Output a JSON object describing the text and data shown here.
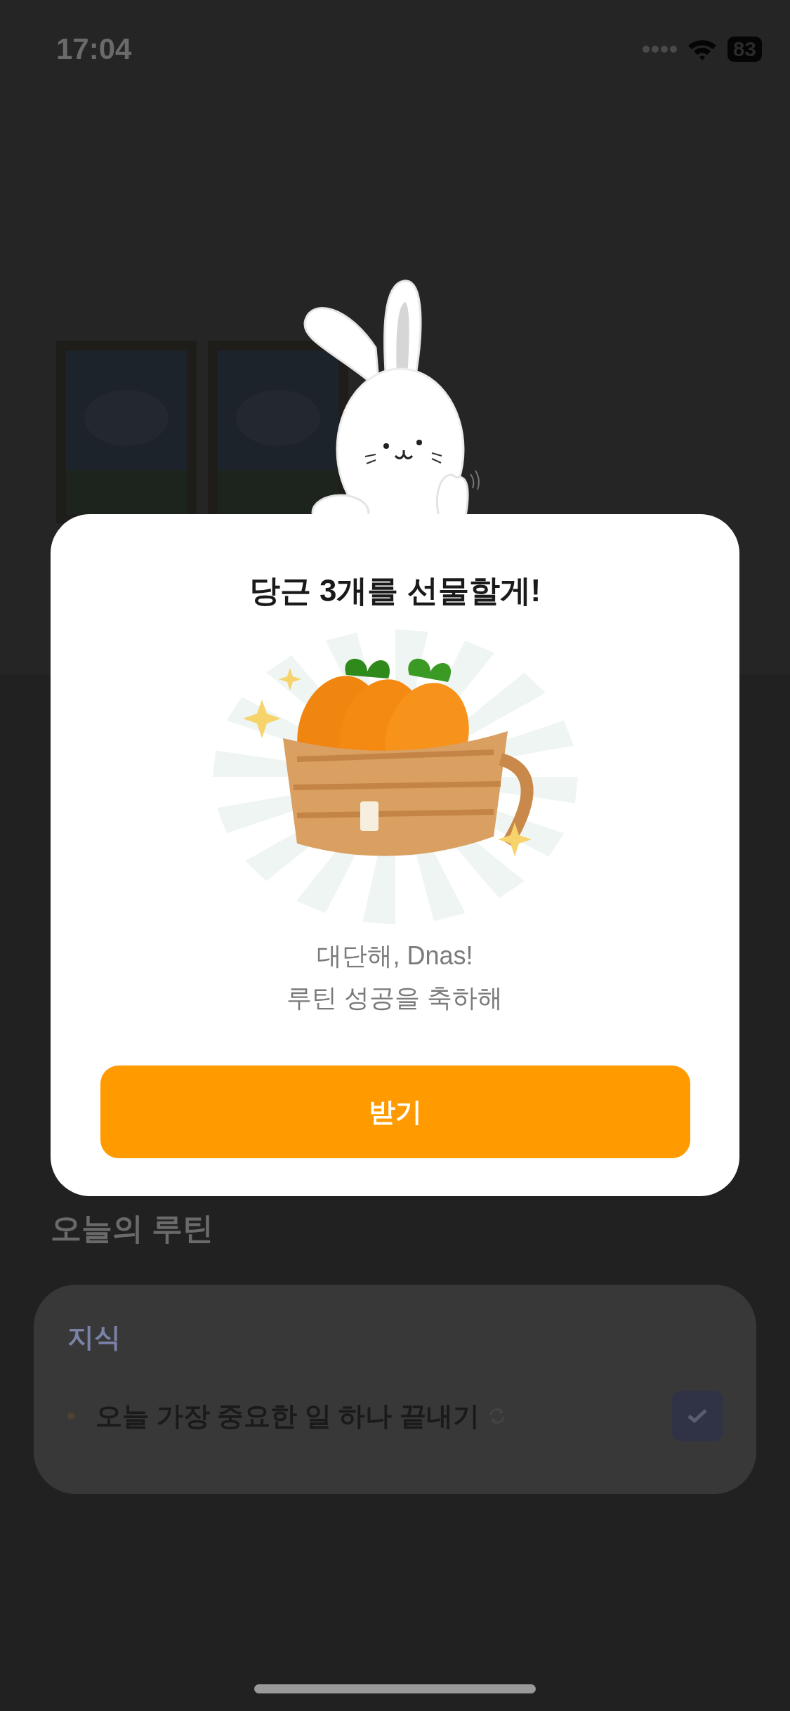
{
  "status_bar": {
    "time": "17:04",
    "battery": "83"
  },
  "modal": {
    "title": "당근 3개를 선물할게!",
    "message_lines": [
      "대단해, Dnas!",
      "루틴 성공을 축하해"
    ],
    "button": "받기"
  },
  "routine": {
    "heading": "오늘의 루틴",
    "category": "지식",
    "tasks": [
      {
        "label": "오늘 가장 중요한 일 하나 끝내기",
        "repeating": true,
        "checked": true
      }
    ]
  }
}
